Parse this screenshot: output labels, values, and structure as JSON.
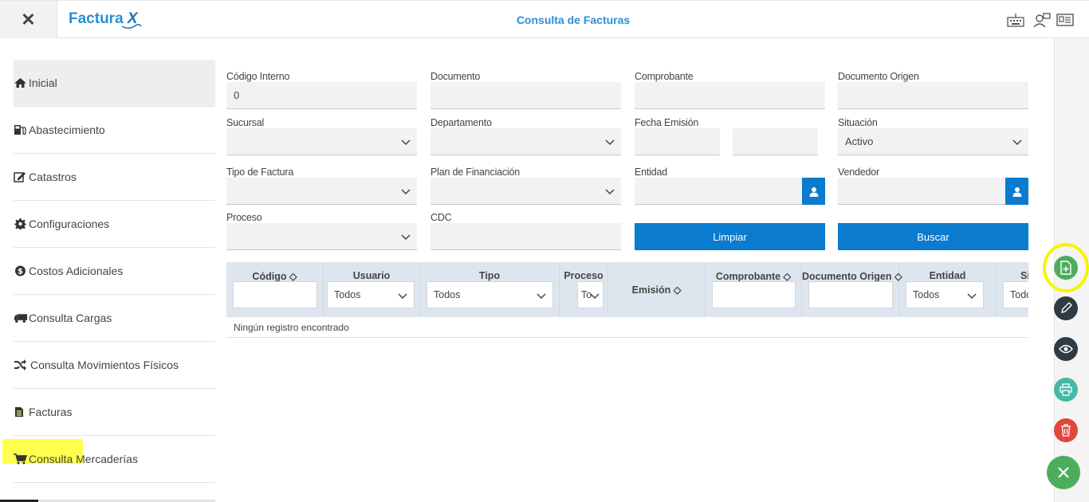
{
  "header": {
    "close_symbol": "✕",
    "logo_text": "Factura",
    "logo_suffix": "X",
    "title": "Consulta de Facturas",
    "icons": [
      "keyboard-icon",
      "users-icon",
      "id-card-icon"
    ]
  },
  "sidebar": {
    "items": [
      {
        "label": "Inicial",
        "icon": "home-icon"
      },
      {
        "label": "Abastecimiento",
        "icon": "fuel-icon"
      },
      {
        "label": "Catastros",
        "icon": "edit-icon"
      },
      {
        "label": "Configuraciones",
        "icon": "gear-icon"
      },
      {
        "label": "Costos Adicionales",
        "icon": "dollar-icon"
      },
      {
        "label": "Consulta Cargas",
        "icon": "truck-icon"
      },
      {
        "label": "Consulta Movimientos Físicos",
        "icon": "shuffle-icon"
      },
      {
        "label": "Facturas",
        "icon": "document-icon"
      },
      {
        "label": "Consulta Mercaderías",
        "icon": "cart-icon"
      }
    ]
  },
  "form": {
    "codigo_interno": {
      "label": "Código Interno",
      "value": "0"
    },
    "documento": {
      "label": "Documento",
      "value": ""
    },
    "comprobante": {
      "label": "Comprobante",
      "value": ""
    },
    "documento_origen": {
      "label": "Documento Origen",
      "value": ""
    },
    "sucursal": {
      "label": "Sucursal",
      "value": ""
    },
    "departamento": {
      "label": "Departamento",
      "value": ""
    },
    "fecha_emision": {
      "label": "Fecha Emisión",
      "from": "",
      "to": ""
    },
    "situacion": {
      "label": "Situación",
      "value": "Activo"
    },
    "tipo_factura": {
      "label": "Tipo de Factura",
      "value": ""
    },
    "plan_financiacion": {
      "label": "Plan de Financiación",
      "value": ""
    },
    "entidad": {
      "label": "Entidad",
      "value": ""
    },
    "vendedor": {
      "label": "Vendedor",
      "value": ""
    },
    "proceso": {
      "label": "Proceso",
      "value": ""
    },
    "cdc": {
      "label": "CDC",
      "value": ""
    },
    "limpiar_label": "Limpiar",
    "buscar_label": "Buscar"
  },
  "table": {
    "columns": [
      {
        "header": "Código ◇",
        "filter": ""
      },
      {
        "header": "Usuario",
        "filter": "Todos"
      },
      {
        "header": "Tipo",
        "filter": "Todos"
      },
      {
        "header": "Proceso",
        "filter": "To"
      },
      {
        "header": "Emisión ◇",
        "filter": null
      },
      {
        "header": "Comprobante ◇",
        "filter": ""
      },
      {
        "header": "Documento Origen ◇",
        "filter": ""
      },
      {
        "header": "Entidad",
        "filter": "Todos"
      },
      {
        "header": "Si",
        "filter": "Todo"
      }
    ],
    "empty_message": "Ningún registro encontrado"
  },
  "actions": [
    "add-document-icon",
    "pencil-icon",
    "eye-icon",
    "printer-icon",
    "trash-icon",
    "close-icon"
  ],
  "colors": {
    "primary": "#0a7bcf",
    "brand": "#2a8fd6",
    "green": "#4cae5a",
    "dark": "#2f3a45",
    "teal": "#45b8a8",
    "red": "#e0473c",
    "highlight": "#ffff4d"
  }
}
